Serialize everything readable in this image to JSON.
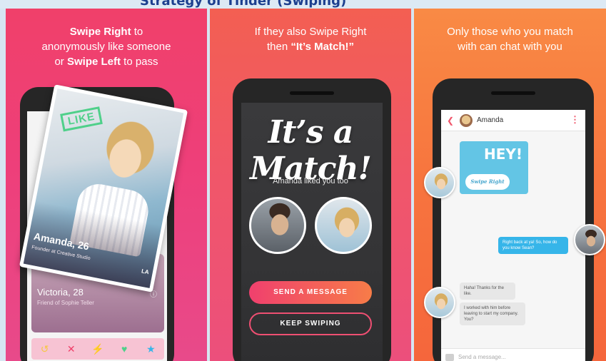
{
  "header": {
    "partial_title": "Strategy of Tinder (Swiping)"
  },
  "panel1": {
    "caption_line1_bold": "Swipe Right",
    "caption_line1_rest": " to",
    "caption_line2": "anonymously like someone",
    "caption_line3_pre": "or ",
    "caption_line3_bold": "Swipe Left",
    "caption_line3_post": " to pass",
    "card": {
      "stamp": "LIKE",
      "name": "Amanda, 26",
      "job": "Founder at Creative Studio",
      "tag": "LA"
    },
    "under_card": {
      "name": "Victoria, 28",
      "job": "Friend of Sophie Teller"
    },
    "actions": [
      {
        "icon": "rewind-icon",
        "glyph": "↺",
        "color": "#f6c744"
      },
      {
        "icon": "nope-icon",
        "glyph": "✕",
        "color": "#f0406a"
      },
      {
        "icon": "boost-icon",
        "glyph": "⚡",
        "color": "#a857e8"
      },
      {
        "icon": "like-icon",
        "glyph": "♥",
        "color": "#4fd08a"
      },
      {
        "icon": "superlike-icon",
        "glyph": "★",
        "color": "#36b5e9"
      }
    ]
  },
  "panel2": {
    "caption_line1": "If they also Swipe Right",
    "caption_line2_pre": "then ",
    "caption_line2_bold": "“It’s Match!”",
    "match_title": "It’s a Match!",
    "liked_text": "Amanda liked you too",
    "send_button": "SEND A MESSAGE",
    "keep_button": "KEEP SWIPING"
  },
  "panel3": {
    "caption_line1": "Only those who you match",
    "caption_line2": "with can chat with you",
    "chat_name": "Amanda",
    "sticker_text": "HEY!",
    "sticker_sub": "Swipe Right",
    "msg_out": "Right back at ya! So, how do you know Sean?",
    "msg_in1": "Haha! Thanks for the like.",
    "msg_in2": "I worked with him before leaving to start my company. You?",
    "input_placeholder": "Send a message..."
  }
}
